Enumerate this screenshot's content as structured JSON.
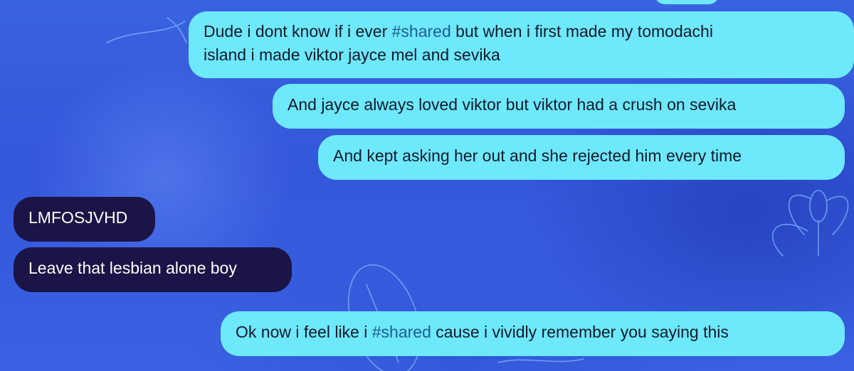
{
  "messages": [
    {
      "direction": "sent",
      "line1_a": "Dude i dont know if i ever ",
      "line1_tag": "#shared",
      "line1_b": " but when i first made my tomodachi",
      "line2": "island i made viktor jayce mel and sevika"
    },
    {
      "direction": "sent",
      "text": "And jayce always loved viktor but viktor had a crush on sevika"
    },
    {
      "direction": "sent",
      "text": "And kept asking her out and she rejected him every time"
    },
    {
      "direction": "received",
      "text": "LMFOSJVHD"
    },
    {
      "direction": "received",
      "text": "Leave that lesbian alone boy"
    },
    {
      "direction": "sent",
      "text_a": "Ok now i feel like i ",
      "tag": "#shared",
      "text_b": " cause i vividly remember you saying this"
    }
  ],
  "colors": {
    "sent_bubble": "#6ee8fb",
    "received_bubble": "#1b1446",
    "hashtag": "#1f5f8a",
    "background": "#3a5fe0"
  }
}
